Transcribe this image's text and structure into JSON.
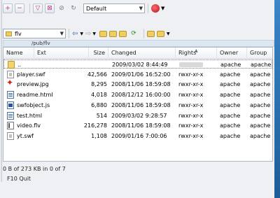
{
  "toolbar1": {
    "buttons": [
      "plus-icon",
      "minus-icon",
      "filter-icon",
      "filter-clear-icon",
      "clear-icon",
      "refresh-icon"
    ],
    "profile_select": "Default",
    "app_icon": "app-menu-icon"
  },
  "toolbar2": {
    "folder_select": "flv",
    "nav_buttons": [
      "back-icon",
      "forward-icon",
      "parent-dir-icon",
      "root-dir-icon",
      "home-icon",
      "refresh-icon",
      "bookmark-icon",
      "favorites-icon"
    ]
  },
  "path": "/pub/flv",
  "columns": {
    "name": "Name",
    "ext": "Ext",
    "size": "Size",
    "changed": "Changed",
    "rights": "Rights",
    "owner": "Owner",
    "group": "Group"
  },
  "files": [
    {
      "name": "..",
      "size": "",
      "changed": "2009/03/02 8:44:49",
      "rights": "",
      "owner": "apache",
      "group": "apache",
      "icon": "up"
    },
    {
      "name": "player.swf",
      "size": "42,566",
      "changed": "2009/01/06 16:52:00",
      "rights": "rwxr-xr-x",
      "owner": "apache",
      "group": "apache",
      "icon": "swf"
    },
    {
      "name": "preview.jpg",
      "size": "8,295",
      "changed": "2008/11/06 18:59:08",
      "rights": "rwxr-xr-x",
      "owner": "apache",
      "group": "apache",
      "icon": "jpg"
    },
    {
      "name": "readme.html",
      "size": "4,018",
      "changed": "2008/12/12 16:00:00",
      "rights": "rwxr-xr-x",
      "owner": "apache",
      "group": "apache",
      "icon": "html"
    },
    {
      "name": "swfobject.js",
      "size": "6,880",
      "changed": "2008/11/06 18:59:08",
      "rights": "rwxr-xr-x",
      "owner": "apache",
      "group": "apache",
      "icon": "js"
    },
    {
      "name": "test.html",
      "size": "514",
      "changed": "2009/03/02 9:28:57",
      "rights": "rwxr-xr-x",
      "owner": "apache",
      "group": "apache",
      "icon": "html"
    },
    {
      "name": "video.flv",
      "size": "216,278",
      "changed": "2008/11/06 18:59:08",
      "rights": "rwxr-xr-x",
      "owner": "apache",
      "group": "apache",
      "icon": "flv"
    },
    {
      "name": "yt.swf",
      "size": "1,108",
      "changed": "2009/01/16 7:00:06",
      "rights": "rwxr-xr-x",
      "owner": "apache",
      "group": "apache",
      "icon": "swf"
    }
  ],
  "status": "0 B of 273 KB in 0 of 7",
  "quit": {
    "key": "F10",
    "label": "Quit"
  }
}
